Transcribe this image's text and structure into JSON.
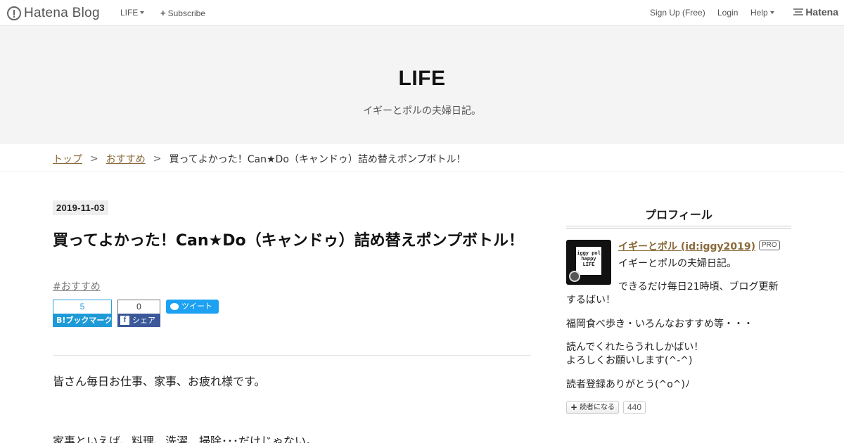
{
  "global_header": {
    "brand": "Hatena Blog",
    "menu_life": "LIFE",
    "subscribe": "Subscribe",
    "signup": "Sign Up (Free)",
    "login": "Login",
    "help": "Help",
    "hatena": "Hatena"
  },
  "blog": {
    "title": "LIFE",
    "description": "イギーとポルの夫婦日記。"
  },
  "breadcrumb": {
    "top": "トップ",
    "category": "おすすめ",
    "current": "買ってよかった！Can★Do（キャンドゥ）詰め替えポンプボトル！",
    "separator": ">"
  },
  "entry": {
    "date": "2019-11-03",
    "title": "買ってよかった！Can★Do（キャンドゥ）詰め替えポンプボトル！",
    "category": "#おすすめ",
    "paragraph1": "皆さん毎日お仕事、家事、お疲れ様です。",
    "paragraph2": "家事といえば、料理、洗濯、掃除･･･だけじゃない。"
  },
  "share": {
    "hatebu_count": "5",
    "hatebu_label": "ブックマーク",
    "hatebu_prefix": "B!",
    "facebook_count": "0",
    "facebook_label": "シェア",
    "tweet_label": "ツイート"
  },
  "sidebar": {
    "profile_title": "プロフィール",
    "avatar_text": "iggy pol\nhappy\nLIFE",
    "name": "イギーとポル (id:iggy2019)",
    "badge": "PRO",
    "line1": "イギーとポルの夫婦日記。",
    "line2a": "できるだけ毎日21時頃、ブログ更新",
    "line2b": "するばい！",
    "line3": "福岡食べ歩き・いろんなおすすめ等・・・",
    "line4a": "読んでくれたらうれしかばい！",
    "line4b": "よろしくお願いします(^-^)",
    "line5": "読者登録ありがとう(^o^)ﾉ",
    "reader_button": "読者になる",
    "reader_count": "440"
  },
  "colors": {
    "link": "#8a6a3a",
    "hatebu": "#1e9ad6",
    "facebook": "#3b5998",
    "twitter": "#1da1f2",
    "header_bg": "#f4f4f4"
  }
}
